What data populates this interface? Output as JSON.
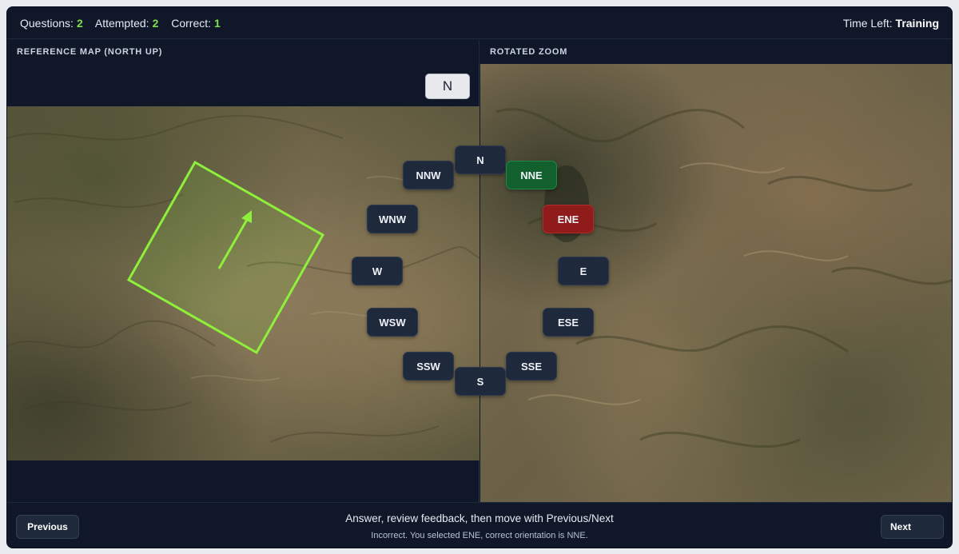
{
  "stats": {
    "questions_label": "Questions:",
    "questions_value": "2",
    "attempted_label": "Attempted:",
    "attempted_value": "2",
    "correct_label": "Correct:",
    "correct_value": "1"
  },
  "timer": {
    "label": "Time Left:",
    "value": "Training"
  },
  "panels": {
    "left_title": "REFERENCE MAP (NORTH UP)",
    "right_title": "ROTATED ZOOM",
    "north_badge": "N"
  },
  "compass": {
    "N": "N",
    "NNE": "NNE",
    "ENE": "ENE",
    "E": "E",
    "ESE": "ESE",
    "SSE": "SSE",
    "S": "S",
    "SSW": "SSW",
    "WSW": "WSW",
    "W": "W",
    "WNW": "WNW",
    "NNW": "NNW",
    "correct": "NNE",
    "selected": "ENE"
  },
  "colors": {
    "overlay_green": "#8ef03a",
    "correct_green": "#12602e",
    "wrong_red": "#8f1b1b",
    "accent_value": "#7ee04a"
  },
  "footer": {
    "previous_label": "Previous",
    "next_label": "Next",
    "instructions": "Answer, review feedback, then move with Previous/Next",
    "feedback": "Incorrect. You selected ENE, correct orientation is NNE."
  }
}
